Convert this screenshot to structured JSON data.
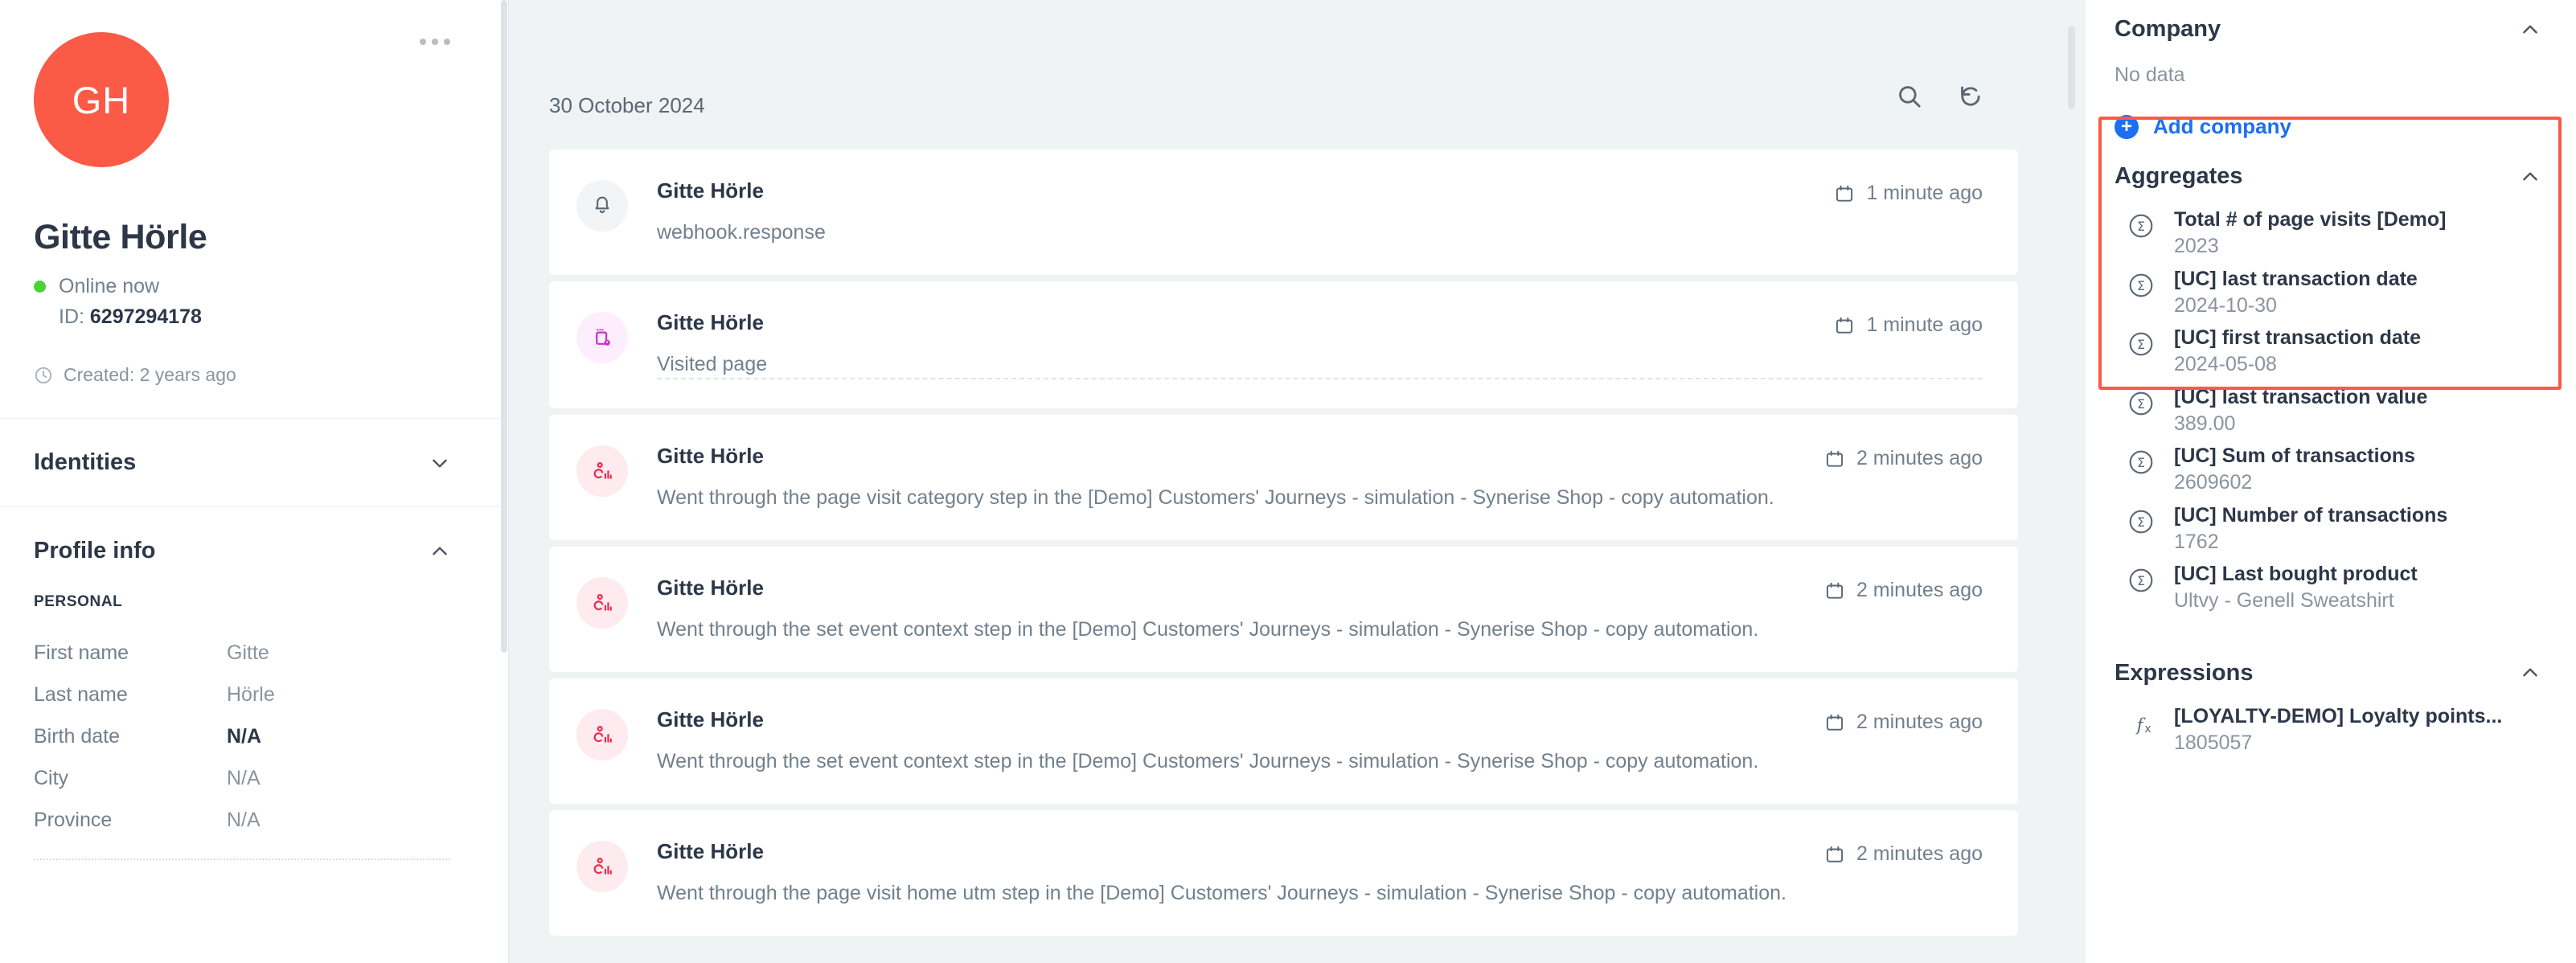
{
  "profile": {
    "avatar_initials": "GH",
    "name": "Gitte Hörle",
    "status": "Online now",
    "id_label": "ID:",
    "id_value": "6297294178",
    "created": "Created: 2 years ago",
    "menu_icon": "kebab-menu-icon",
    "clock_icon": "clock-icon"
  },
  "identities": {
    "title": "Identities"
  },
  "profile_info": {
    "title": "Profile info",
    "subhead": "PERSONAL",
    "fields": [
      {
        "label": "First name",
        "value": "Gitte",
        "bold": false
      },
      {
        "label": "Last name",
        "value": "Hörle",
        "bold": false
      },
      {
        "label": "Birth date",
        "value": "N/A",
        "bold": true
      },
      {
        "label": "City",
        "value": "N/A",
        "bold": false
      },
      {
        "label": "Province",
        "value": "N/A",
        "bold": false
      }
    ]
  },
  "main": {
    "date": "30 October 2024",
    "search_icon": "search-icon",
    "refresh_icon": "refresh-icon",
    "events": [
      {
        "name": "Gitte Hörle",
        "desc": "webhook.response",
        "time": "1 minute ago",
        "icon": "bell-icon",
        "icon_tone": "grey",
        "separator": false
      },
      {
        "name": "Gitte Hörle",
        "desc": "Visited page",
        "time": "1 minute ago",
        "icon": "visited-page-icon",
        "icon_tone": "purple",
        "separator": true
      },
      {
        "name": "Gitte Hörle",
        "desc": "Went through the page visit category step in the [Demo] Customers' Journeys - simulation - Synerise Shop - copy automation.",
        "time": "2 minutes ago",
        "icon": "automation-step-icon",
        "icon_tone": "pink",
        "separator": false
      },
      {
        "name": "Gitte Hörle",
        "desc": "Went through the set event context step in the [Demo] Customers' Journeys - simulation - Synerise Shop - copy automation.",
        "time": "2 minutes ago",
        "icon": "automation-step-icon",
        "icon_tone": "pink",
        "separator": false
      },
      {
        "name": "Gitte Hörle",
        "desc": "Went through the set event context step in the [Demo] Customers' Journeys - simulation - Synerise Shop - copy automation.",
        "time": "2 minutes ago",
        "icon": "automation-step-icon",
        "icon_tone": "pink",
        "separator": false
      },
      {
        "name": "Gitte Hörle",
        "desc": "Went through the page visit home utm step in the [Demo] Customers' Journeys - simulation - Synerise Shop - copy automation.",
        "time": "2 minutes ago",
        "icon": "automation-step-icon",
        "icon_tone": "pink",
        "separator": false
      }
    ]
  },
  "right": {
    "company": {
      "title": "Company",
      "no_data": "No data",
      "add_label": "Add company",
      "add_icon": "plus-circle-icon"
    },
    "aggregates": {
      "title": "Aggregates",
      "items": [
        {
          "label": "Total # of page visits [Demo]",
          "value": "2023",
          "icon": "sigma-icon"
        },
        {
          "label": "[UC] last transaction date",
          "value": "2024-10-30",
          "icon": "sigma-icon"
        },
        {
          "label": "[UC] first transaction date",
          "value": "2024-05-08",
          "icon": "sigma-icon"
        },
        {
          "label": "[UC] last transaction value",
          "value": "389.00",
          "icon": "sigma-icon"
        },
        {
          "label": "[UC] Sum of transactions",
          "value": "2609602",
          "icon": "sigma-icon"
        },
        {
          "label": "[UC] Number of transactions",
          "value": "1762",
          "icon": "sigma-icon"
        },
        {
          "label": "[UC] Last bought product",
          "value": "Ultvy - Genell Sweatshirt",
          "icon": "sigma-icon"
        }
      ]
    },
    "expressions": {
      "title": "Expressions",
      "items": [
        {
          "label": "[LOYALTY-DEMO] Loyalty points...",
          "value": "1805057",
          "icon": "fx-icon"
        }
      ]
    }
  },
  "colors": {
    "avatar_bg": "#fb5a47",
    "online_dot": "#4cd137",
    "link_blue": "#1d6ff2",
    "highlight_border": "#fb5a47",
    "main_bg": "#eff3f4",
    "text_primary": "#2d3748",
    "text_secondary": "#72808e"
  }
}
